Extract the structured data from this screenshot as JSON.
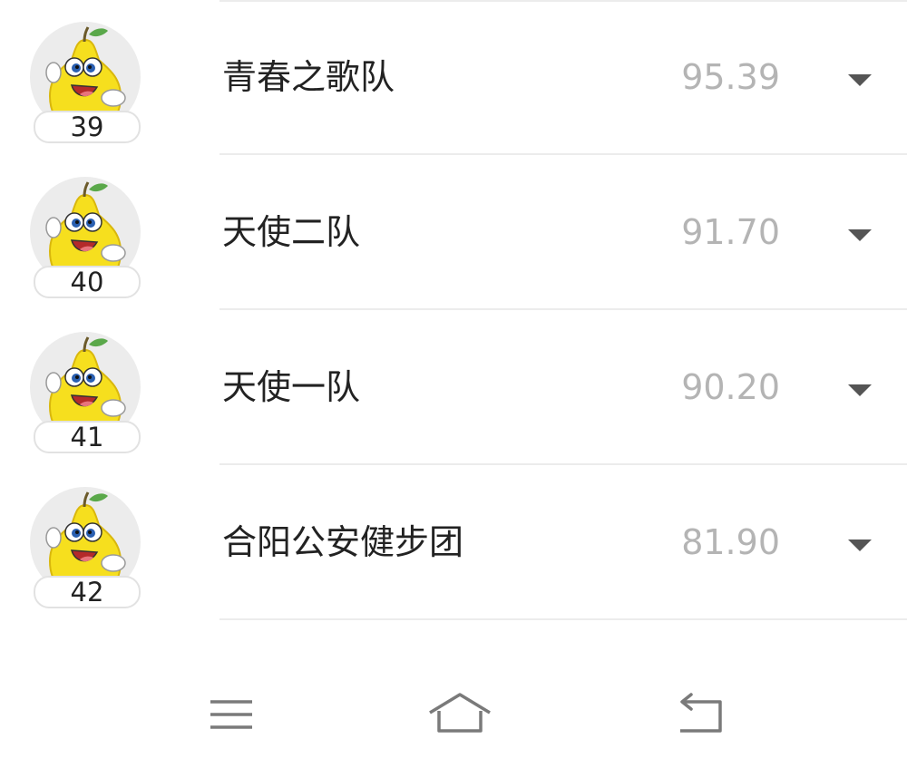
{
  "teams": [
    {
      "rank": "39",
      "name": "青春之歌队",
      "score": "95.39"
    },
    {
      "rank": "40",
      "name": "天使二队",
      "score": "91.70"
    },
    {
      "rank": "41",
      "name": "天使一队",
      "score": "90.20"
    },
    {
      "rank": "42",
      "name": "合阳公安健步团",
      "score": "81.90"
    }
  ],
  "icons": {
    "avatar": "pear-mascot-icon",
    "expand": "caret-down-icon",
    "nav_menu": "menu-icon",
    "nav_home": "home-icon",
    "nav_back": "back-icon"
  },
  "colors": {
    "team_name": "#222222",
    "score": "#b4b4b4",
    "divider": "#ececec",
    "avatar_bg": "#ececec",
    "mascot_yellow": "#f6df1e"
  }
}
